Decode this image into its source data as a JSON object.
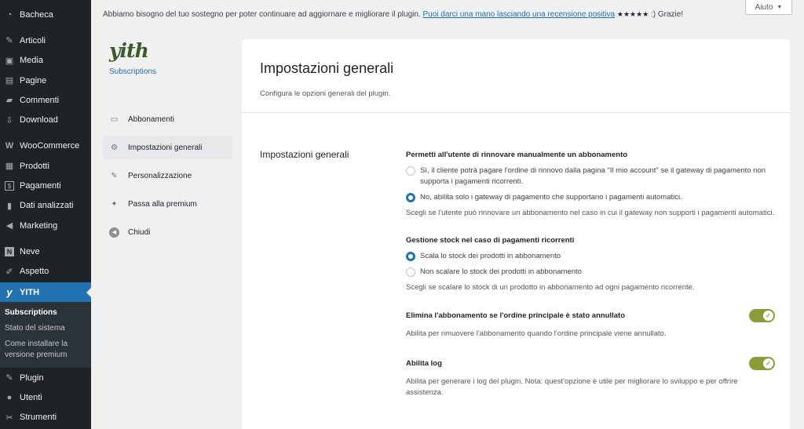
{
  "wp_menu": {
    "items": [
      {
        "label": "Bacheca",
        "icon": "dashboard-icon",
        "glyph": "◔"
      },
      {
        "label": "Articoli",
        "icon": "pin-icon",
        "glyph": "✎"
      },
      {
        "label": "Media",
        "icon": "media-icon",
        "glyph": "▣"
      },
      {
        "label": "Pagine",
        "icon": "pages-icon",
        "glyph": "▤"
      },
      {
        "label": "Commenti",
        "icon": "comments-icon",
        "glyph": "▰"
      },
      {
        "label": "Download",
        "icon": "download-icon",
        "glyph": "⇩"
      },
      {
        "label": "WooCommerce",
        "icon": "woocommerce-icon",
        "glyph": "W"
      },
      {
        "label": "Prodotti",
        "icon": "products-icon",
        "glyph": "▦"
      },
      {
        "label": "Pagamenti",
        "icon": "payments-icon",
        "glyph": "$"
      },
      {
        "label": "Dati analizzati",
        "icon": "analytics-icon",
        "glyph": "▮"
      },
      {
        "label": "Marketing",
        "icon": "megaphone-icon",
        "glyph": "◀"
      },
      {
        "label": "Neve",
        "icon": "neve-icon",
        "glyph": "N"
      },
      {
        "label": "Aspetto",
        "icon": "brush-icon",
        "glyph": "✐"
      },
      {
        "label": "YITH",
        "icon": "yith-icon",
        "glyph": "y"
      },
      {
        "label": "Plugin",
        "icon": "plugin-icon",
        "glyph": "✎"
      },
      {
        "label": "Utenti",
        "icon": "users-icon",
        "glyph": "●"
      },
      {
        "label": "Strumenti",
        "icon": "tools-icon",
        "glyph": "✂"
      }
    ],
    "submenu": [
      {
        "label": "Subscriptions"
      },
      {
        "label": "Stato del sistema"
      },
      {
        "label": "Come installare la versione premium"
      }
    ]
  },
  "notice": {
    "text": "Abbiamo bisogno del tuo sostegno per poter continuare ad aggiornare e migliorare il plugin.",
    "link": "Puoi darci una mano lasciando una recensione positiva",
    "stars": "★★★★★",
    "suffix": ":) Grazie!"
  },
  "help_button": {
    "label": "Aiuto"
  },
  "plugin": {
    "logo": "yith",
    "name": "Subscriptions",
    "nav": [
      {
        "label": "Abbonamenti",
        "icon": "subscriptions-icon",
        "glyph": "▭"
      },
      {
        "label": "Impostazioni generali",
        "icon": "settings-gear-icon",
        "glyph": "⚙"
      },
      {
        "label": "Personalizzazione",
        "icon": "brush-icon",
        "glyph": "✎"
      },
      {
        "label": "Passa alla premium",
        "icon": "sparkle-icon",
        "glyph": "✦"
      },
      {
        "label": "Chiudi",
        "icon": "close-circle-icon",
        "glyph": "◀"
      }
    ]
  },
  "main": {
    "title": "Impostazioni generali",
    "description": "Configura le opzioni generali del plugin.",
    "section_label": "Impostazioni generali",
    "renew": {
      "title": "Permetti all'utente di rinnovare manualmente un abbonamento",
      "option_yes": "Sì, il cliente potrà pagare l'ordine di rinnovo dalla pagina \"Il mio account\" se il gateway di pagamento non supporta i pagamenti ricorrenti.",
      "option_no": "No, abilita solo i gateway di pagamento che supportano i pagamenti automatici.",
      "help": "Scegli se l'utente può rinnovare un abbonamento nel caso in cui il gateway non supporti i pagamenti automatici."
    },
    "stock": {
      "title": "Gestione stock nel caso di pagamenti ricorrenti",
      "option_scale": "Scala lo stock dei prodotti in abbonamento",
      "option_noscale": "Non scalare lo stock dei prodotti in abbonamento",
      "help": "Scegli se scalare lo stock di un prodotto in abbonamento ad ogni pagamento ricorrente."
    },
    "delete_sub": {
      "title": "Elimina l'abbonamento se l'ordine principale è stato annullato",
      "help": "Abilita per rimuovere l'abbonamento quando l'ordine principale viene annullato."
    },
    "log": {
      "title": "Abilita log",
      "help": "Abilita per generare i log del plugin. Nota: quest'opzione è utile per migliorare lo sviluppo e per offrire assistenza."
    }
  },
  "colors": {
    "accent": "#2271b1",
    "toggle_on": "#8a9b3a",
    "sidebar_bg": "#1d2327"
  }
}
